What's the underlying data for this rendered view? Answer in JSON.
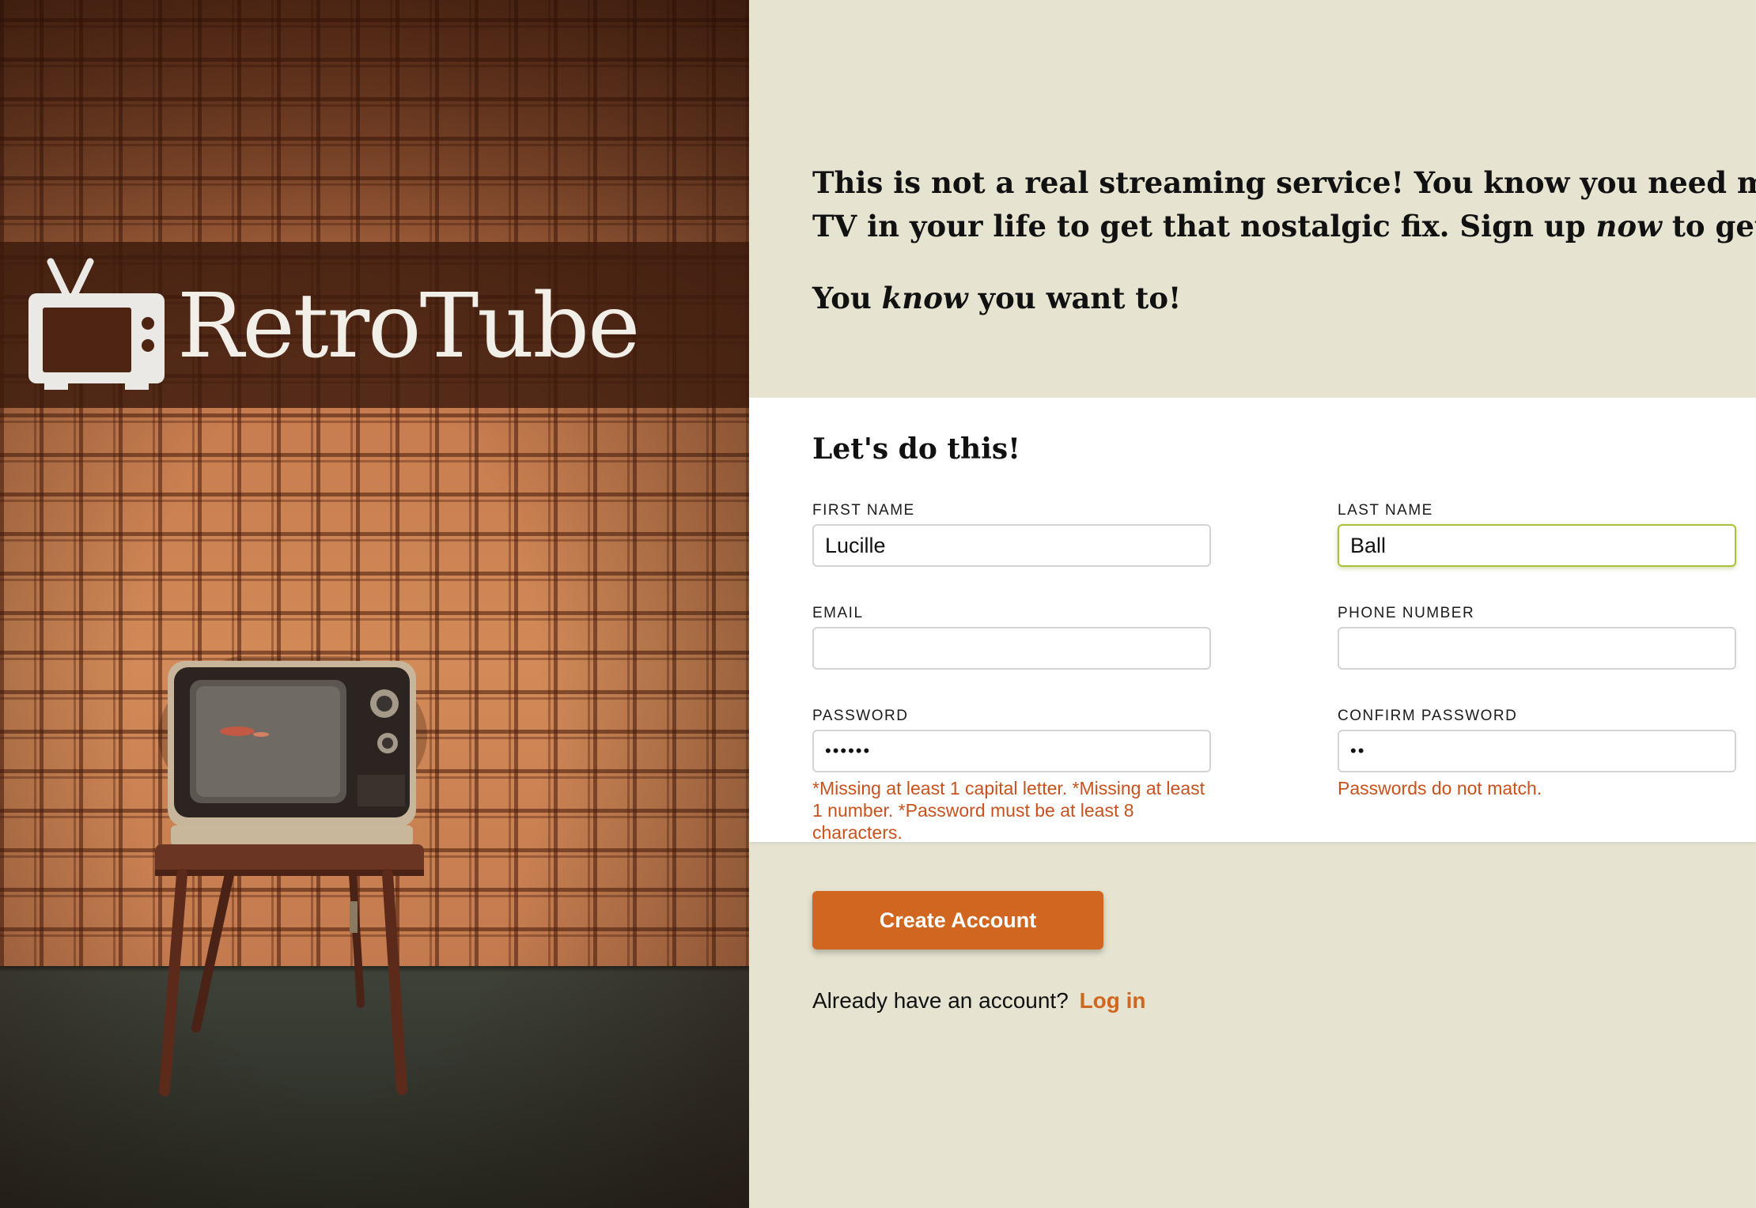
{
  "brand": {
    "name": "RetroTube",
    "logo_icon": "tv-icon"
  },
  "intro": {
    "line1": "This is not a real streaming service! You know you need more",
    "line2_start": "TV in your life to get that nostalgic fix. Sign up ",
    "line2_em": "now",
    "line2_end": " to get star",
    "line3_start": "You ",
    "line3_em": "know",
    "line3_end": " you want to!"
  },
  "form": {
    "title": "Let's do this!",
    "first_name": {
      "label": "FIRST NAME",
      "value": "Lucille"
    },
    "last_name": {
      "label": "LAST NAME",
      "value": "Ball"
    },
    "email": {
      "label": "EMAIL",
      "value": ""
    },
    "phone": {
      "label": "PHONE NUMBER",
      "value": ""
    },
    "password": {
      "label": "PASSWORD",
      "value": "••••••",
      "error": "*Missing at least 1 capital letter. *Missing at least 1 number. *Password must be at least 8 characters."
    },
    "confirm_password": {
      "label": "CONFIRM PASSWORD",
      "value": "••",
      "error": "Passwords do not match."
    },
    "submit_label": "Create Account"
  },
  "login": {
    "prompt": "Already have an account?",
    "link_label": "Log in"
  },
  "colors": {
    "accent": "#d0661f",
    "error": "#c8521e",
    "focus": "#a7c236",
    "panel_bg": "#e6e4d1"
  }
}
